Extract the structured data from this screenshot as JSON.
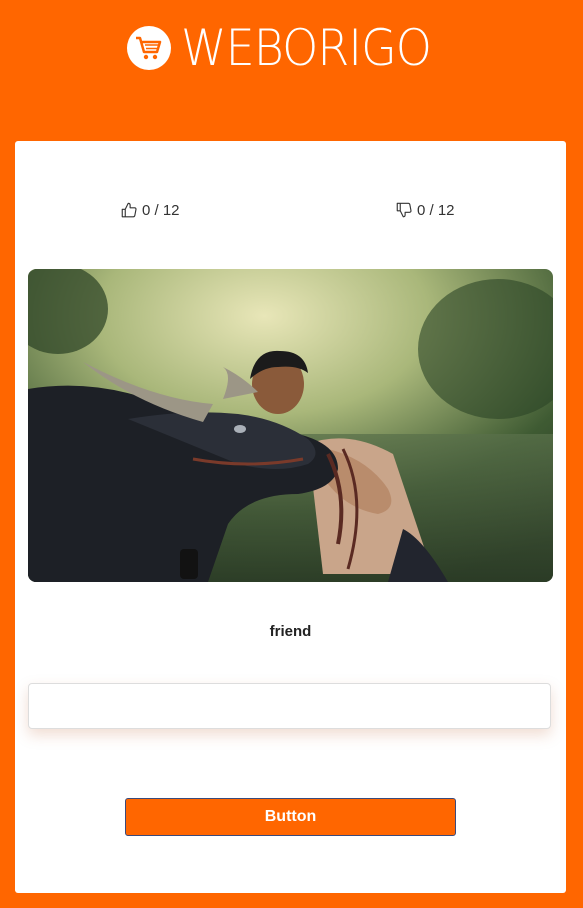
{
  "brand": {
    "name": "WEBORIGO",
    "icon": "shopping-cart-icon"
  },
  "votes": {
    "likes": "0 / 12",
    "dislikes": "0 / 12"
  },
  "image": {
    "subject": "man-with-water-buffalo-photo"
  },
  "caption": "friend",
  "answer": {
    "value": "",
    "placeholder": ""
  },
  "button": {
    "label": "Button"
  },
  "colors": {
    "accent": "#ff6600",
    "card": "#ffffff"
  }
}
